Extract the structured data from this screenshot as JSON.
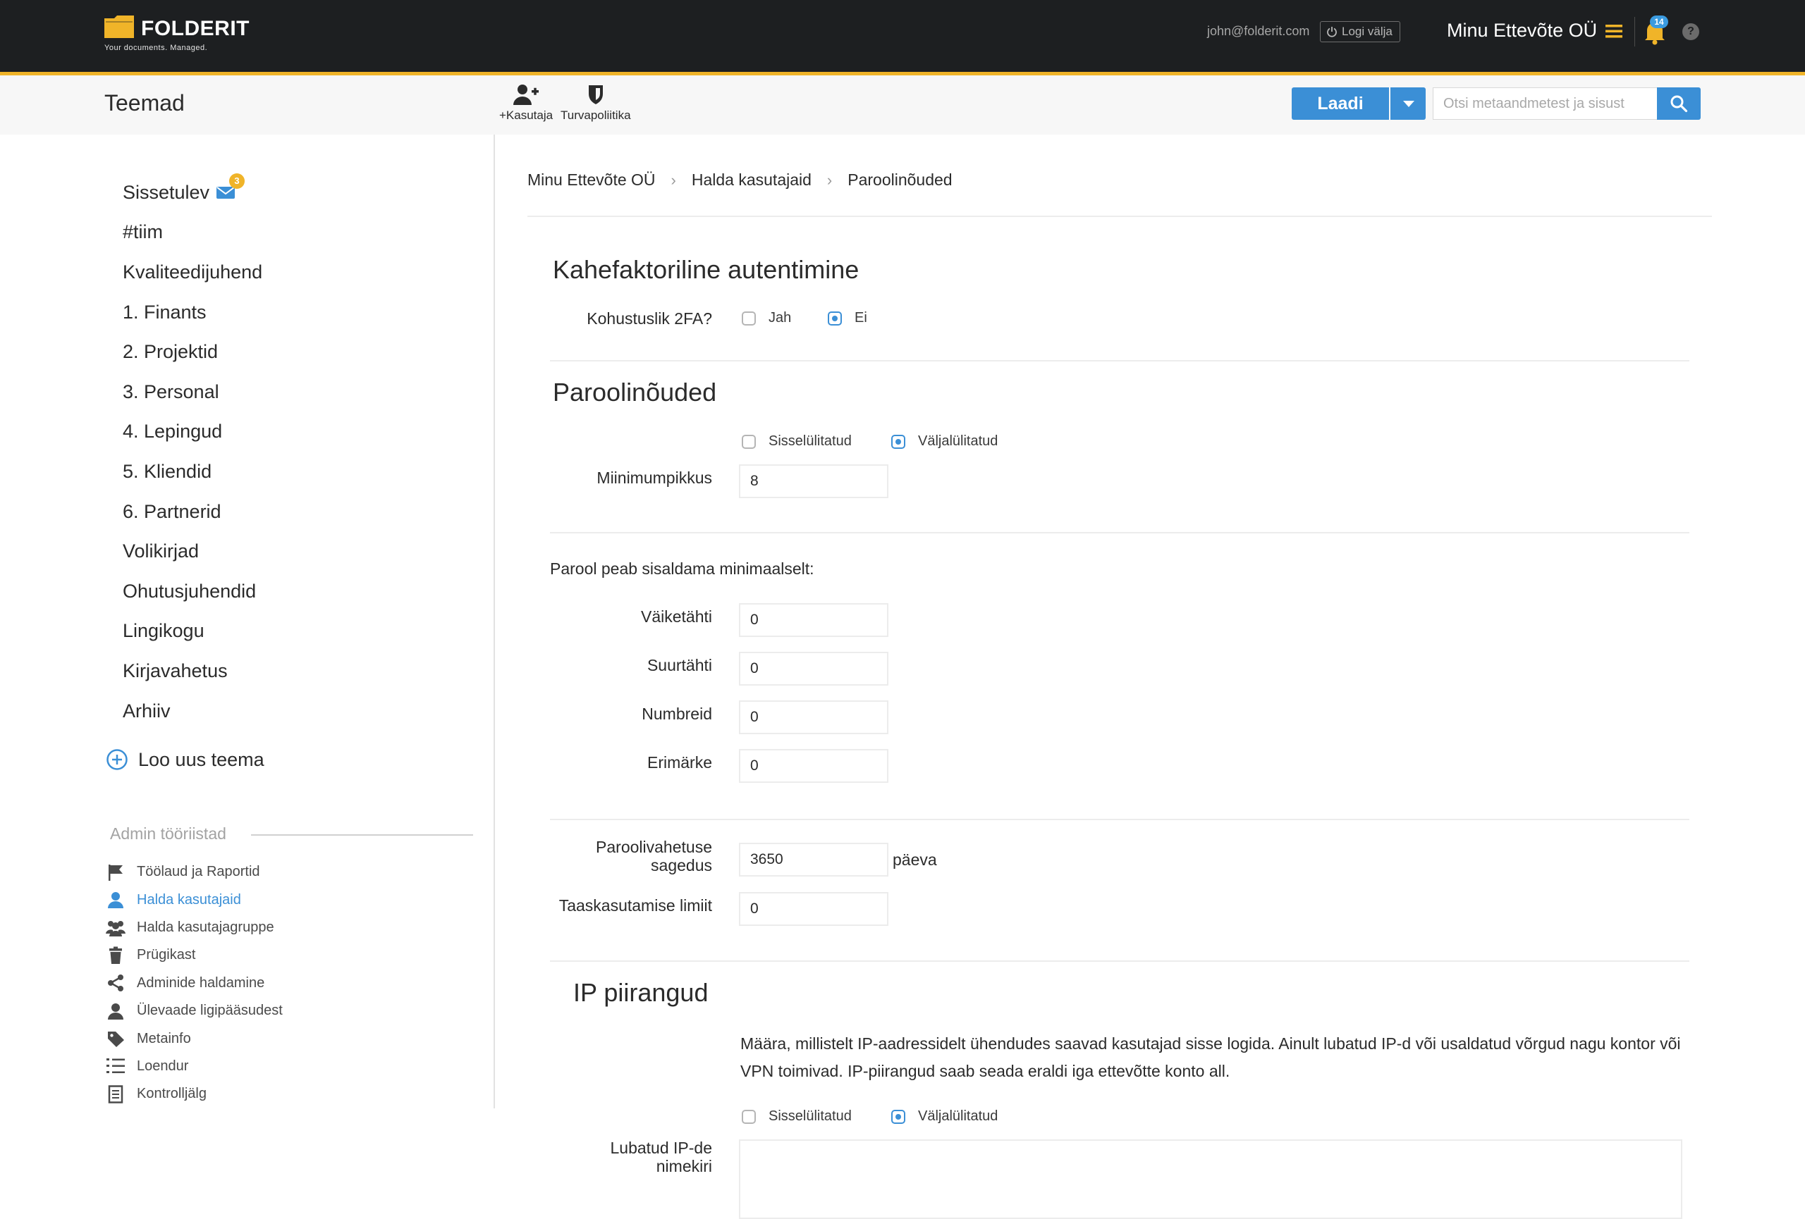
{
  "header": {
    "logo_name": "FOLDERIT",
    "logo_tagline": "Your documents. Managed.",
    "user_email": "john@folderit.com",
    "logout_label": "Logi välja",
    "company_name": "Minu Ettevõte OÜ",
    "notification_count": "14",
    "help_label": "?"
  },
  "subheader": {
    "title": "Teemad",
    "add_user_label": "+Kasutaja",
    "security_policy_label": "Turvapoliitika",
    "upload_label": "Laadi",
    "search_placeholder": "Otsi metaandmetest ja sisust"
  },
  "sidebar": {
    "themes": [
      {
        "label": "Sissetulev",
        "badge": "3"
      },
      {
        "label": "#tiim"
      },
      {
        "label": "Kvaliteedijuhend"
      },
      {
        "label": "1. Finants"
      },
      {
        "label": "2. Projektid"
      },
      {
        "label": "3. Personal"
      },
      {
        "label": "4. Lepingud"
      },
      {
        "label": "5. Kliendid"
      },
      {
        "label": "6. Partnerid"
      },
      {
        "label": "Volikirjad"
      },
      {
        "label": "Ohutusjuhendid"
      },
      {
        "label": "Lingikogu"
      },
      {
        "label": "Kirjavahetus"
      },
      {
        "label": "Arhiiv"
      }
    ],
    "new_theme_label": "Loo uus teema",
    "admin_heading": "Admin tööriistad",
    "admin_items": [
      {
        "label": "Töölaud ja Raportid",
        "icon": "flag-icon"
      },
      {
        "label": "Halda kasutajaid",
        "icon": "user-icon",
        "active": true
      },
      {
        "label": "Halda kasutajagruppe",
        "icon": "users-group-icon"
      },
      {
        "label": "Prügikast",
        "icon": "trash-icon"
      },
      {
        "label": "Adminide haldamine",
        "icon": "share-icon"
      },
      {
        "label": "Ülevaade ligipääsudest",
        "icon": "user-icon"
      },
      {
        "label": "Metainfo",
        "icon": "tag-icon"
      },
      {
        "label": "Loendur",
        "icon": "numbered-list-icon"
      },
      {
        "label": "Kontrolljälg",
        "icon": "document-icon"
      }
    ]
  },
  "breadcrumb": [
    "Minu Ettevõte OÜ",
    "Halda kasutajaid",
    "Paroolinõuded"
  ],
  "two_factor": {
    "title": "Kahefaktoriline autentimine",
    "label": "Kohustuslik 2FA?",
    "option_yes": "Jah",
    "option_no": "Ei",
    "selected": "Ei"
  },
  "password": {
    "title": "Paroolinõuded",
    "option_on": "Sisselülitatud",
    "option_off": "Väljalülitatud",
    "selected": "Väljalülitatud",
    "min_length_label": "Miinimumpikkus",
    "min_length_value": "8",
    "must_contain_label": "Parool peab sisaldama minimaalselt:",
    "lowercase_label": "Väiketähti",
    "lowercase_value": "0",
    "uppercase_label": "Suurtähti",
    "uppercase_value": "0",
    "numbers_label": "Numbreid",
    "numbers_value": "0",
    "special_label": "Erimärke",
    "special_value": "0",
    "change_freq_label_1": "Paroolivahetuse",
    "change_freq_label_2": "sagedus",
    "change_freq_value": "3650",
    "change_freq_unit": "päeva",
    "reuse_limit_label": "Taaskasutamise limiit",
    "reuse_limit_value": "0"
  },
  "ip": {
    "title": "IP piirangud",
    "description": "Määra, millistelt IP-aadressidelt ühendudes saavad kasutajad sisse logida. Ainult lubatud IP-d või usaldatud võrgud nagu kontor või VPN toimivad. IP-piirangud saab seada eraldi iga ettevõtte konto all.",
    "option_on": "Sisselülitatud",
    "option_off": "Väljalülitatud",
    "selected": "Väljalülitatud",
    "allowed_list_label_1": "Lubatud IP-de",
    "allowed_list_label_2": "nimekiri",
    "allowed_list_value": ""
  },
  "colors": {
    "topbar": "#1d1f21",
    "accent": "#f0b429",
    "primary": "#3b8fd6",
    "sidebar_active": "#3b8fd6"
  }
}
